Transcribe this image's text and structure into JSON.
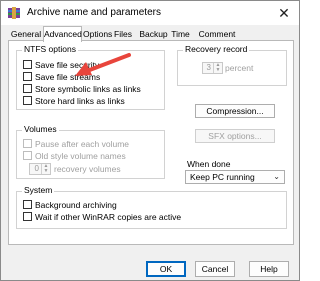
{
  "window": {
    "title": "Archive name and parameters",
    "close_symbol": "✕"
  },
  "tabs": [
    {
      "label": "General",
      "active": false
    },
    {
      "label": "Advanced",
      "active": true
    },
    {
      "label": "Options",
      "active": false
    },
    {
      "label": "Files",
      "active": false
    },
    {
      "label": "Backup",
      "active": false
    },
    {
      "label": "Time",
      "active": false
    },
    {
      "label": "Comment",
      "active": false
    }
  ],
  "ntfs": {
    "title": "NTFS options",
    "items": [
      {
        "label": "Save file security",
        "checked": false
      },
      {
        "label": "Save file streams",
        "checked": false
      },
      {
        "label": "Store symbolic links as links",
        "checked": false
      },
      {
        "label": "Store hard links as links",
        "checked": false
      }
    ]
  },
  "recovery": {
    "title": "Recovery record",
    "value": "3",
    "suffix": "percent"
  },
  "volumes": {
    "title": "Volumes",
    "pause_label": "Pause after each volume",
    "old_style_label": "Old style volume names",
    "recovery_value": "0",
    "recovery_suffix": "recovery volumes"
  },
  "buttons": {
    "compression": "Compression...",
    "sfx": "SFX options..."
  },
  "when_done": {
    "label": "When done",
    "selected": "Keep PC running"
  },
  "system": {
    "title": "System",
    "background_label": "Background archiving",
    "wait_label": "Wait if other WinRAR copies are active"
  },
  "footer": {
    "ok": "OK",
    "cancel": "Cancel",
    "help": "Help"
  },
  "colors": {
    "arrow": "#e8453c",
    "accent": "#0067c0"
  },
  "icons": {
    "app": "winrar-archive-icon",
    "close": "close-icon",
    "dropdown": "chevron-down-icon"
  }
}
